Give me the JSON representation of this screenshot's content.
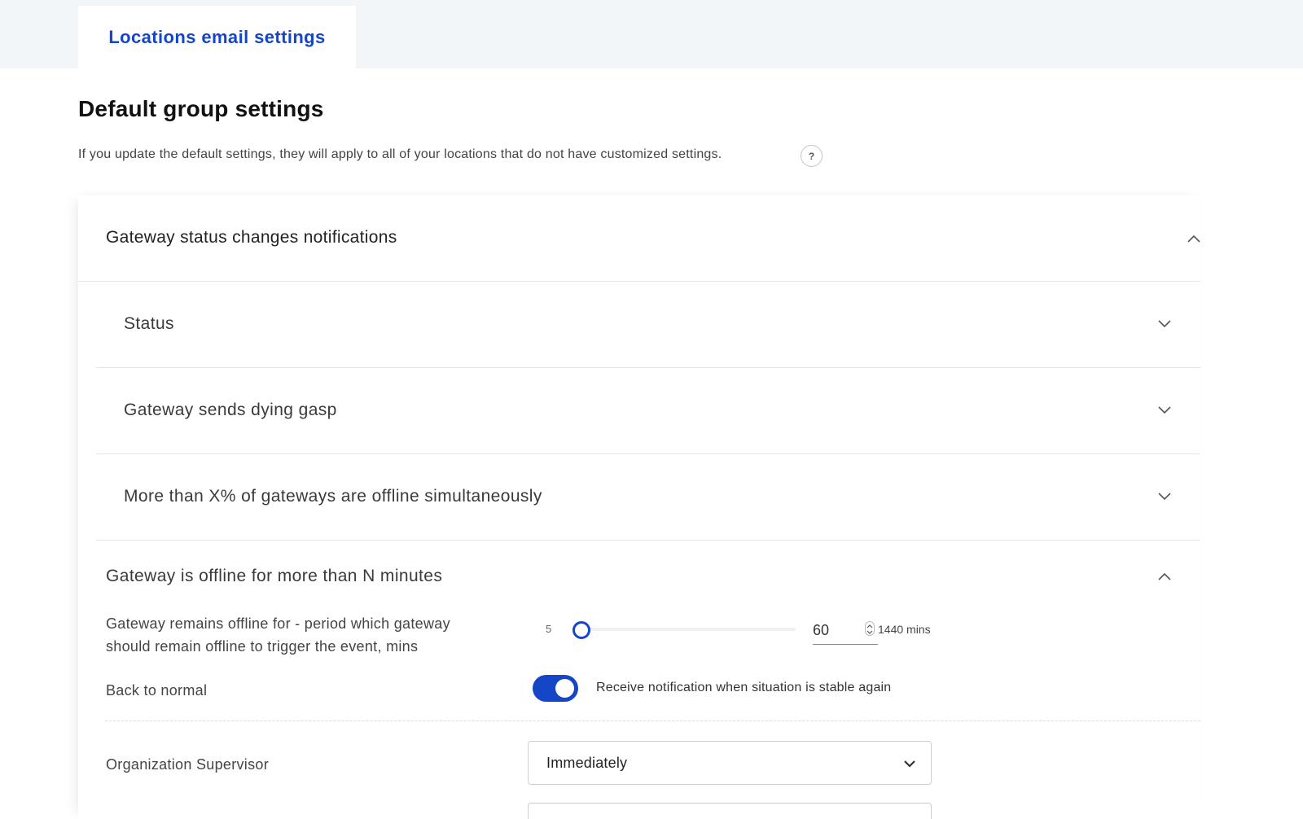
{
  "tabs": {
    "active_label": "Locations email settings"
  },
  "page": {
    "title": "Default group settings",
    "intro": "If you update the default settings, they will apply to all of your locations that do not have customized settings.",
    "help_icon": "question-mark"
  },
  "section": {
    "title": "Gateway status changes notifications",
    "subsections": [
      {
        "label": "Status"
      },
      {
        "label": "Gateway sends dying gasp"
      },
      {
        "label": "More than X% of gateways are offline simultaneously"
      },
      {
        "label": "Gateway is offline for more than N minutes"
      }
    ]
  },
  "offline_settings": {
    "period_label_line1": "Gateway remains offline for - period which gateway",
    "period_label_line2": "should remain offline to trigger the event, mins",
    "slider_min": "5",
    "slider_max_label": "1440 mins",
    "slider_value": "60",
    "slider_min_value": 5,
    "slider_max_value": 1440,
    "back_to_normal_label": "Back to normal",
    "back_to_normal_text": "Receive notification when situation is stable again",
    "back_to_normal_enabled": true
  },
  "recipients": {
    "org_supervisor_label": "Organization Supervisor",
    "org_supervisor_value": "Immediately"
  },
  "colors": {
    "accent": "#1646c8",
    "topbar": "#f3f6f9"
  }
}
